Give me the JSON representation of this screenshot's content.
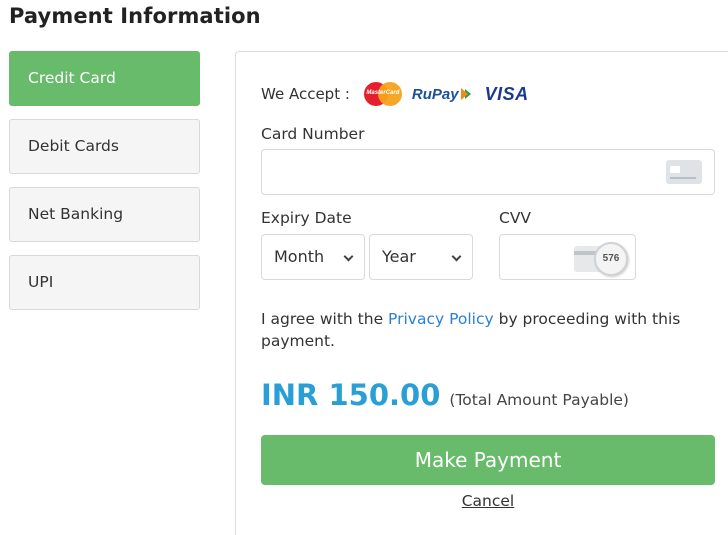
{
  "page": {
    "title": "Payment Information"
  },
  "tabs": [
    {
      "label": "Credit Card",
      "active": true
    },
    {
      "label": "Debit Cards",
      "active": false
    },
    {
      "label": "Net Banking",
      "active": false
    },
    {
      "label": "UPI",
      "active": false
    }
  ],
  "accept": {
    "label": "We Accept :",
    "logos": {
      "mastercard": "MasterCard",
      "rupay": "RuPay",
      "visa": "VISA"
    }
  },
  "card_number": {
    "label": "Card Number",
    "value": "",
    "placeholder": ""
  },
  "expiry": {
    "label": "Expiry Date",
    "month": "Month",
    "year": "Year"
  },
  "cvv": {
    "label": "CVV",
    "value": "",
    "icon_text": "576"
  },
  "agreement": {
    "prefix": "I agree with the ",
    "link": "Privacy Policy",
    "suffix": " by proceeding with this payment."
  },
  "amount": {
    "value": "INR 150.00",
    "note": "(Total Amount Payable)"
  },
  "actions": {
    "pay": "Make Payment",
    "cancel": "Cancel"
  },
  "colors": {
    "accent_green": "#67bb6a",
    "amount_blue": "#2a9fd6",
    "link_blue": "#2a7fd4"
  }
}
